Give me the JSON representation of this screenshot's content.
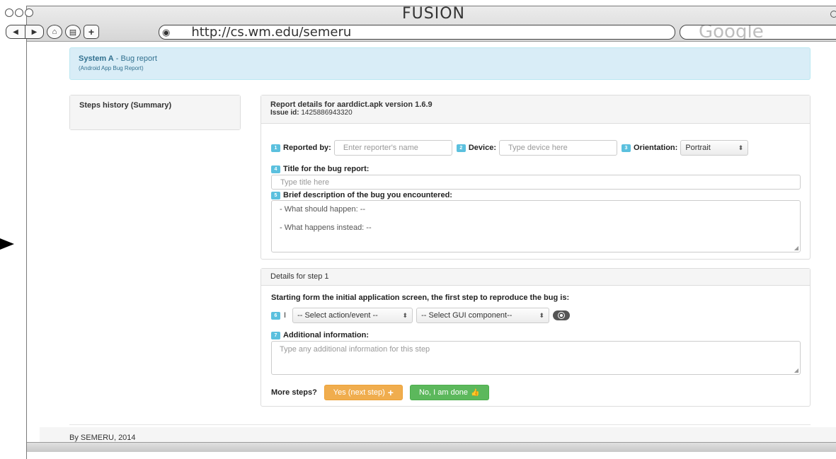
{
  "window": {
    "title": "FUSION",
    "url": "http://cs.wm.edu/semeru",
    "search_placeholder": "Google"
  },
  "alert": {
    "title_bold": "System A",
    "title_rest": " - Bug report",
    "subtitle": "(Android App Bug Report)"
  },
  "history": {
    "heading": "Steps history (Summary)"
  },
  "report": {
    "heading": "Report details for aarddict.apk version 1.6.9",
    "issue_label": "Issue id:",
    "issue_id": " 1425886943320",
    "fields": {
      "reporter": {
        "num": "1",
        "label": "Reported by:",
        "placeholder": "Enter reporter's name"
      },
      "device": {
        "num": "2",
        "label": "Device:",
        "placeholder": "Type device here"
      },
      "orientation": {
        "num": "3",
        "label": "Orientation:",
        "value": "Portrait"
      },
      "title": {
        "num": "4",
        "label": "Title for the bug report:",
        "placeholder": "Type title here"
      },
      "description": {
        "num": "5",
        "label": "Brief description of the bug you encountered:",
        "line1": "- What should happen: --",
        "line2": "- What happens instead: --"
      }
    }
  },
  "step": {
    "heading": "Details for step 1",
    "intro": "Starting form the initial application screen, the first step to reproduce the bug is:",
    "num": "6",
    "subject": "I",
    "action_select": "-- Select action/event --",
    "component_select": "-- Select GUI component--",
    "additional": {
      "num": "7",
      "label": "Additional information:",
      "placeholder": "Type any additional information for this step"
    },
    "more_label": "More steps?",
    "yes_button": "Yes (next step)",
    "yes_icon": "+",
    "no_button": "No, I am done",
    "no_icon": "👍"
  },
  "footer": {
    "text": "By SEMERU, 2014"
  },
  "colors": {
    "info_bg": "#d9edf7",
    "badge": "#5bc0de",
    "warning": "#f0ad4e",
    "success": "#5cb85c"
  }
}
